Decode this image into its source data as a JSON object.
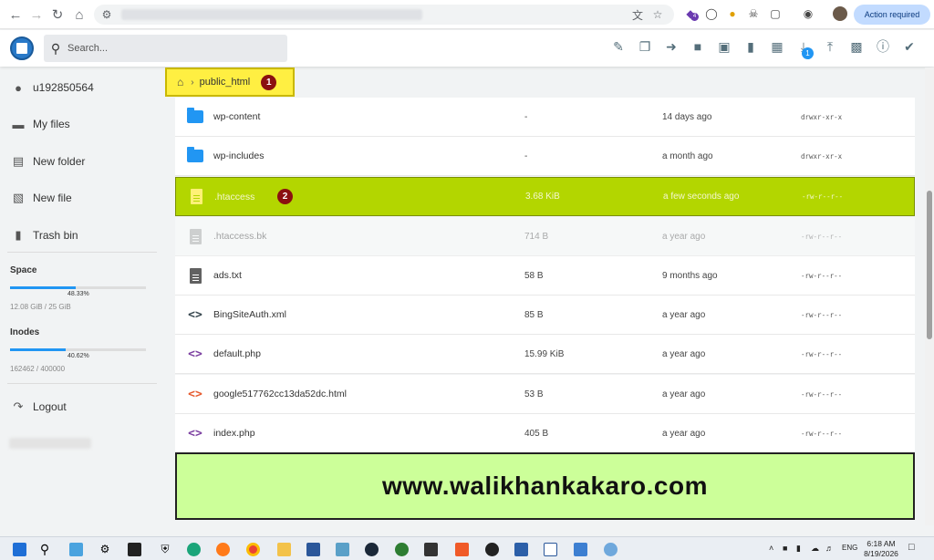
{
  "browser": {
    "action_label": "Action required",
    "extension_badge": "4"
  },
  "header": {
    "search_placeholder": "Search...",
    "download_badge": "1"
  },
  "sidebar": {
    "user": "u192850564",
    "items": [
      {
        "label": "My files",
        "icon": "folder-icon"
      },
      {
        "label": "New folder",
        "icon": "new-folder-icon"
      },
      {
        "label": "New file",
        "icon": "new-file-icon"
      },
      {
        "label": "Trash bin",
        "icon": "trash-icon"
      }
    ],
    "space": {
      "title": "Space",
      "percent_label": "48.33%",
      "percent": 48.33,
      "text": "12.08 GiB / 25 GiB"
    },
    "inodes": {
      "title": "Inodes",
      "percent_label": "40.62%",
      "percent": 40.62,
      "text": "162462 / 400000"
    },
    "logout": "Logout"
  },
  "breadcrumb": {
    "current": "public_html",
    "marker": "1"
  },
  "files": [
    {
      "name": "wp-content",
      "size": "-",
      "modified": "14 days ago",
      "perm": "drwxr-xr-x",
      "icon": "folder-icon"
    },
    {
      "name": "wp-includes",
      "size": "-",
      "modified": "a month ago",
      "perm": "drwxr-xr-x",
      "icon": "folder-icon"
    },
    {
      "name": ".htaccess",
      "size": "3.68 KiB",
      "modified": "a few seconds ago",
      "perm": "-rw-r--r--",
      "icon": "document-icon",
      "marker": "2"
    },
    {
      "name": ".htaccess.bk",
      "size": "714 B",
      "modified": "a year ago",
      "perm": "-rw-r--r--",
      "icon": "document-icon"
    },
    {
      "name": "ads.txt",
      "size": "58 B",
      "modified": "9 months ago",
      "perm": "-rw-r--r--",
      "icon": "document-icon"
    },
    {
      "name": "BingSiteAuth.xml",
      "size": "85 B",
      "modified": "a year ago",
      "perm": "-rw-r--r--",
      "icon": "code-icon"
    },
    {
      "name": "default.php",
      "size": "15.99 KiB",
      "modified": "a year ago",
      "perm": "-rw-r--r--",
      "icon": "code-icon"
    },
    {
      "name": "google517762cc13da52dc.html",
      "size": "53 B",
      "modified": "a year ago",
      "perm": "-rw-r--r--",
      "icon": "code-icon"
    },
    {
      "name": "index.php",
      "size": "405 B",
      "modified": "a year ago",
      "perm": "-rw-r--r--",
      "icon": "code-icon"
    }
  ],
  "banner": "www.walikhankakaro.com",
  "taskbar": {
    "time": "6:18 AM",
    "date": "8/19/2026",
    "lang": "ENG"
  },
  "colors": {
    "accent": "#2196f3",
    "highlight": "#b3d600",
    "breadcrumb_bg": "#ffef42",
    "marker": "#8b1010",
    "banner_bg": "#ccff99",
    "code_xml": "#37474f",
    "code_php": "#7b3fa0",
    "code_html": "#e65a2e"
  }
}
